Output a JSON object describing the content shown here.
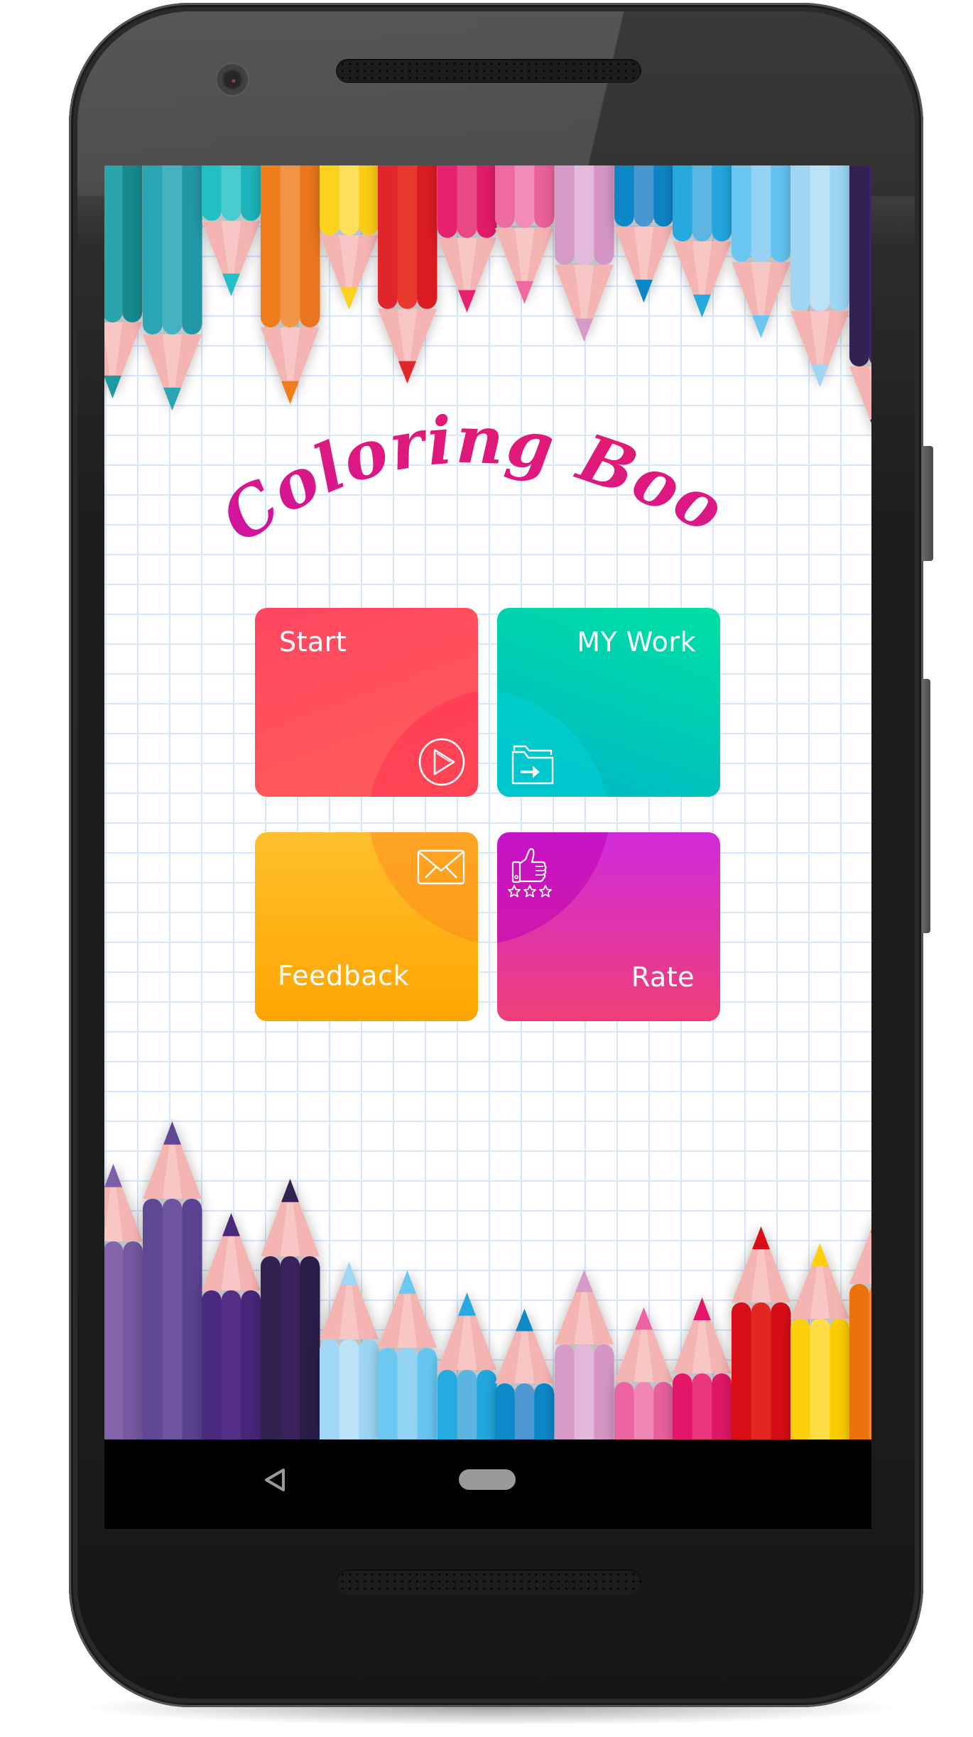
{
  "app": {
    "title": "Coloring Book",
    "title_gradient": [
      "#cc13a8",
      "#ec1e5a"
    ]
  },
  "menu": {
    "cards": [
      {
        "id": "start",
        "label": "Start",
        "icon": "play-circle-icon",
        "colors": [
          "#ff4660",
          "#ff5e5a"
        ]
      },
      {
        "id": "mywork",
        "label": "MY Work",
        "icon": "folder-arrow-icon",
        "colors": [
          "#00e0a3",
          "#00b6c8"
        ]
      },
      {
        "id": "feedback",
        "label": "Feedback",
        "icon": "envelope-icon",
        "colors": [
          "#fdc02d",
          "#ffa500"
        ]
      },
      {
        "id": "rate",
        "label": "Rate",
        "icon": "thumbs-up-stars-icon",
        "colors": [
          "#d02adc",
          "#ef3f78"
        ]
      }
    ]
  },
  "decor": {
    "top_pencils": [
      {
        "color": "#1c9aa0",
        "dark": "#178a8f",
        "light": "#2aa5ab"
      },
      {
        "color": "#2aa5b5",
        "dark": "#2497a6",
        "light": "#44b3bf"
      },
      {
        "color": "#22c0c6",
        "dark": "#1db4ba",
        "light": "#49cbd0"
      },
      {
        "color": "#ef7d1f",
        "dark": "#e9761a",
        "light": "#f29444"
      },
      {
        "color": "#fdd21f",
        "dark": "#fbcc16",
        "light": "#ffe05a"
      },
      {
        "color": "#e0262b",
        "dark": "#d91c22",
        "light": "#e8392f"
      },
      {
        "color": "#e5246f",
        "dark": "#e01b68",
        "light": "#ea4785"
      },
      {
        "color": "#ee6ba0",
        "dark": "#ea6199",
        "light": "#f18cb6"
      },
      {
        "color": "#d79ac7",
        "dark": "#d495c4",
        "light": "#e3badb"
      },
      {
        "color": "#0786c7",
        "dark": "#0883c4",
        "light": "#4a97d0"
      },
      {
        "color": "#28a9df",
        "dark": "#23a6de",
        "light": "#5bb6e2"
      },
      {
        "color": "#6bc6f1",
        "dark": "#64c3f0",
        "light": "#94d3f3"
      },
      {
        "color": "#a0d6f3",
        "dark": "#9dd5f4",
        "light": "#bde2f6"
      },
      {
        "color": "#312152",
        "dark": "#2d1f4e",
        "light": "#3a2860"
      }
    ],
    "bottom_pencils": [
      {
        "color": "#7b5ea6",
        "dark": "#7559a0",
        "light": "#8465ac"
      },
      {
        "color": "#5e4694",
        "dark": "#5a4391",
        "light": "#6e529e"
      },
      {
        "color": "#4a2a7c",
        "dark": "#472779",
        "light": "#552e88"
      },
      {
        "color": "#30204f",
        "dark": "#2c1d4a",
        "light": "#3b245c"
      },
      {
        "color": "#a0d7f5",
        "dark": "#9cd5f4",
        "light": "#bce3f7"
      },
      {
        "color": "#6cc8f1",
        "dark": "#66c5f0",
        "light": "#90d3f3"
      },
      {
        "color": "#25aae0",
        "dark": "#22a7df",
        "light": "#5bb5e1"
      },
      {
        "color": "#0889c8",
        "dark": "#0886c6",
        "light": "#4d98d1"
      },
      {
        "color": "#d89ac8",
        "dark": "#d596c5",
        "light": "#e2b8da"
      },
      {
        "color": "#eb64a0",
        "dark": "#e85f9c",
        "light": "#f086b3"
      },
      {
        "color": "#e3156a",
        "dark": "#e01466",
        "light": "#e9367c"
      },
      {
        "color": "#d80f14",
        "dark": "#d60e14",
        "light": "#e22620"
      },
      {
        "color": "#fdcf08",
        "dark": "#fbcc04",
        "light": "#ffdd45"
      },
      {
        "color": "#ec7208",
        "dark": "#e96f06",
        "light": "#f18a30"
      }
    ],
    "pencil_tip_wood": "#f4b4b2",
    "pencil_tip_wood_light": "#f8c6c4",
    "grid_color": "#d6e7fb"
  },
  "navbar": {
    "back": "back-triangle-icon",
    "home": "home-pill-icon",
    "icon_color": "#9a9a9a"
  }
}
